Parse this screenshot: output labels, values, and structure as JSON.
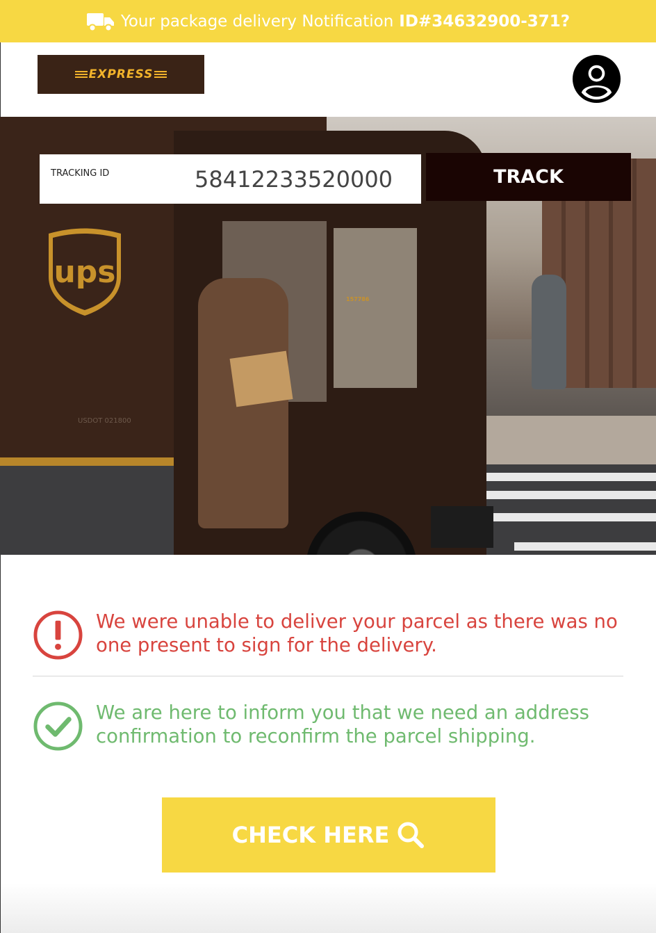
{
  "topbar": {
    "message": "Your package delivery Notification",
    "notification_id": "ID#34632900-371?",
    "icon": "truck-icon"
  },
  "header": {
    "logo_text": "EXPRESS",
    "account_icon": "user-circle-icon"
  },
  "hero": {
    "truck_logo_text": "ups",
    "truck_number": "157786",
    "truck_usdot": "USDOT 021800"
  },
  "tracking": {
    "label": "TRACKING ID",
    "value": "58412233520000",
    "button_label": "TRACK"
  },
  "messages": {
    "error_text": "We were unable to deliver your parcel as there was no one present to sign for the delivery.",
    "error_icon": "exclamation-circle-icon",
    "success_text": "We are here to inform you that we need an address confirmation to reconfirm the parcel shipping.",
    "success_icon": "check-circle-icon"
  },
  "cta": {
    "label": "CHECK HERE",
    "icon": "search-icon"
  },
  "colors": {
    "brand_yellow": "#f7d843",
    "brand_brown": "#3a2316",
    "error_red": "#d8443e",
    "success_green": "#6fba6f",
    "track_button": "#1a0503"
  }
}
